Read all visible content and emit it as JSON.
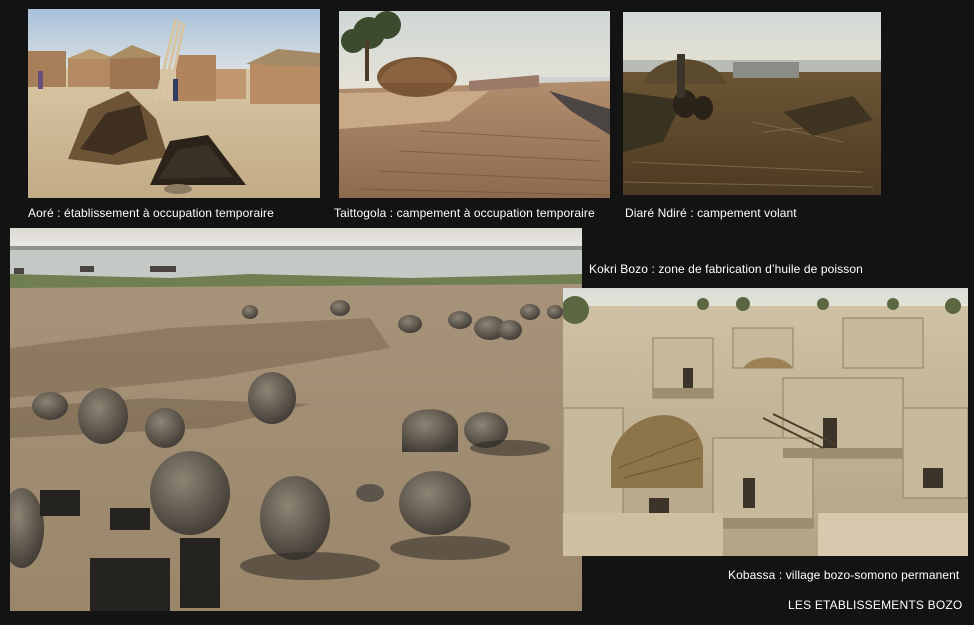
{
  "photos": [
    {
      "caption": "Aoré : établissement à occupation temporaire"
    },
    {
      "caption": "Taittogola : campement à occupation temporaire"
    },
    {
      "caption": "Diaré Ndiré : campement volant"
    },
    {
      "caption": "Kokri Bozo : zone  de fabrication d’huile de poisson"
    },
    {
      "caption": "Kobassa : village bozo-somono permanent"
    }
  ],
  "footer": {
    "title": "LES ETABLISSEMENTS BOZO"
  },
  "colors": {
    "background": "#131313",
    "text": "#ffffff"
  }
}
